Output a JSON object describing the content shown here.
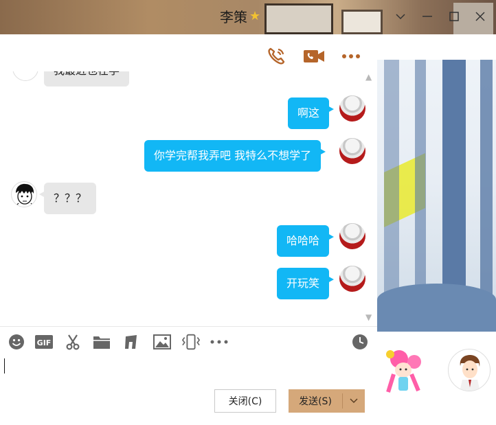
{
  "window": {
    "title": "李策",
    "controls": [
      "chevron-down-icon",
      "minimize-icon",
      "maximize-icon",
      "close-icon"
    ]
  },
  "chat_header": {
    "actions": [
      "phone-icon",
      "video-icon",
      "more-icon"
    ]
  },
  "messages": [
    {
      "direction": "in",
      "text": "我最近也在学",
      "partial": true
    },
    {
      "direction": "out",
      "text": "啊这"
    },
    {
      "direction": "out",
      "text": "你学完帮我弄吧 我特么不想学了"
    },
    {
      "direction": "in",
      "text": "？？？"
    },
    {
      "direction": "out",
      "text": "哈哈哈"
    },
    {
      "direction": "out",
      "text": "开玩笑"
    }
  ],
  "toolbar": {
    "tools": [
      "emoji-icon",
      "gif-icon",
      "scissors-icon",
      "folder-icon",
      "music-icon",
      "image-icon",
      "shake-icon",
      "more-tools-icon"
    ],
    "history": "clock-icon"
  },
  "input": {
    "value": ""
  },
  "buttons": {
    "close_label": "关闭(C)",
    "send_label": "发送(S)"
  },
  "colors": {
    "outgoing_bubble": "#12b7f5",
    "incoming_bubble": "#e7e7e7",
    "send_button": "#d5a87a",
    "header_icon": "#b5652a"
  }
}
